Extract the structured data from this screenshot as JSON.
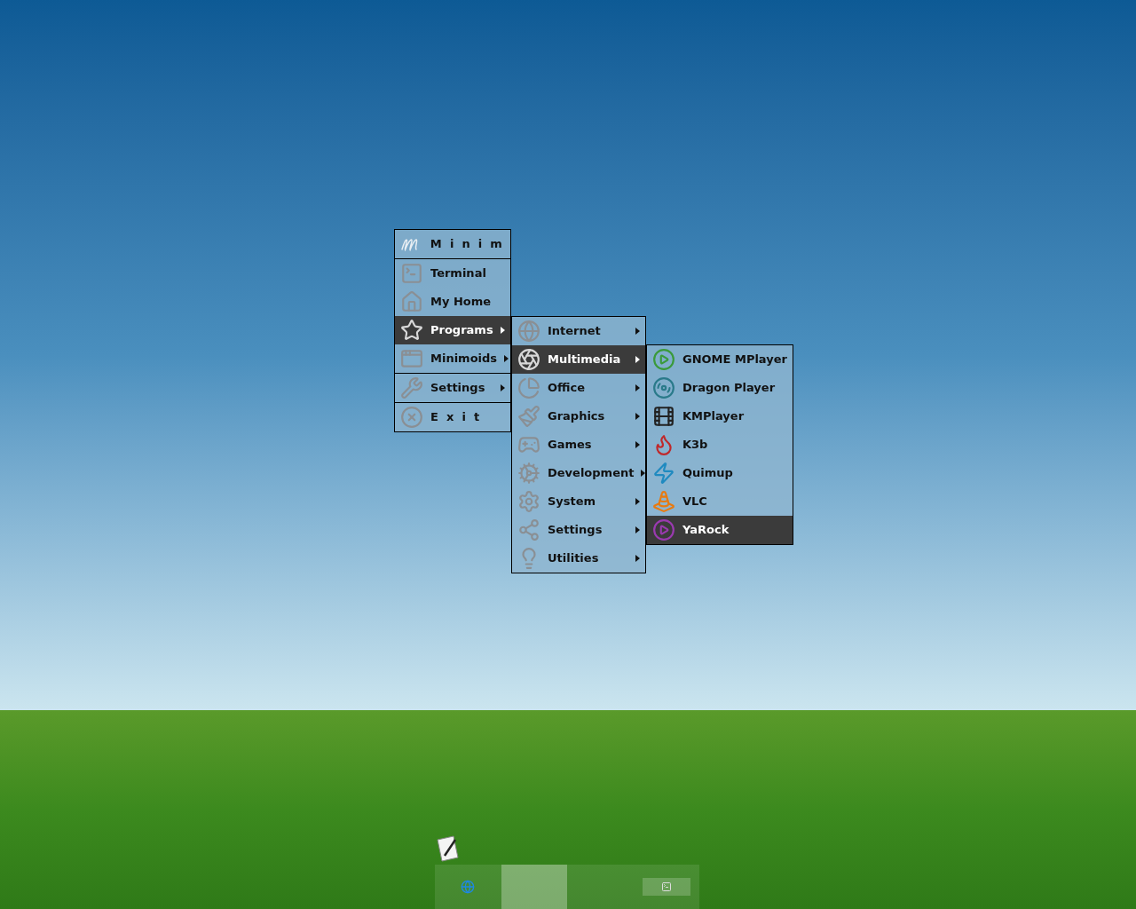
{
  "menu": {
    "title": "Minim",
    "groups": [
      [
        {
          "label": "Terminal",
          "selected": false,
          "has_submenu": false
        },
        {
          "label": "My Home",
          "selected": false,
          "has_submenu": false
        },
        {
          "label": "Programs",
          "selected": true,
          "has_submenu": true
        },
        {
          "label": "Minimoids",
          "selected": false,
          "has_submenu": true
        }
      ],
      [
        {
          "label": "Settings",
          "selected": false,
          "has_submenu": true
        }
      ],
      [
        {
          "label": "Exit",
          "selected": false,
          "has_submenu": false
        }
      ]
    ]
  },
  "programs_menu": [
    {
      "label": "Internet",
      "selected": false,
      "has_submenu": true
    },
    {
      "label": "Multimedia",
      "selected": true,
      "has_submenu": true
    },
    {
      "label": "Office",
      "selected": false,
      "has_submenu": true
    },
    {
      "label": "Graphics",
      "selected": false,
      "has_submenu": true
    },
    {
      "label": "Games",
      "selected": false,
      "has_submenu": true
    },
    {
      "label": "Development",
      "selected": false,
      "has_submenu": true
    },
    {
      "label": "System",
      "selected": false,
      "has_submenu": true
    },
    {
      "label": "Settings",
      "selected": false,
      "has_submenu": true
    },
    {
      "label": "Utilities",
      "selected": false,
      "has_submenu": true
    }
  ],
  "multimedia_menu": [
    {
      "label": "GNOME MPlayer",
      "selected": false
    },
    {
      "label": "Dragon Player",
      "selected": false
    },
    {
      "label": "KMPlayer",
      "selected": false
    },
    {
      "label": "K3b",
      "selected": false
    },
    {
      "label": "Quimup",
      "selected": false
    },
    {
      "label": "VLC",
      "selected": false
    },
    {
      "label": "YaRock",
      "selected": true
    }
  ],
  "dock": {
    "segments": [
      {
        "selected": false
      },
      {
        "selected": true
      },
      {
        "selected": false
      },
      {
        "selected": false
      }
    ]
  }
}
